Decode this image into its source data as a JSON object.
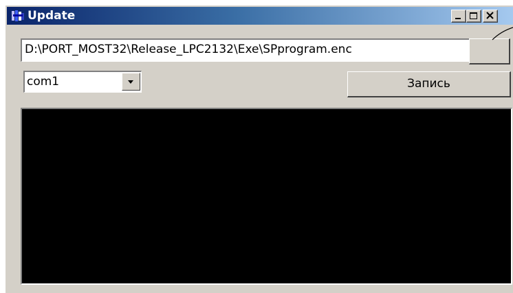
{
  "window": {
    "title": "Update",
    "icon": "app-icon",
    "controls": [
      "minimize-icon",
      "maximize-icon",
      "close-icon"
    ]
  },
  "path_field": {
    "value": "D:\\PORT_MOST32\\Release_LPC2132\\Exe\\SPprogram.enc"
  },
  "browse_button": {
    "label": ""
  },
  "port_select": {
    "value": "com1",
    "icon": "chevron-down-icon"
  },
  "write_button": {
    "label": "Запись"
  },
  "output_console": {
    "background": "#000000"
  },
  "colors": {
    "title_gradient_start": "#0a246a",
    "title_gradient_end": "#a6caf0",
    "face": "#d4d0c8"
  }
}
